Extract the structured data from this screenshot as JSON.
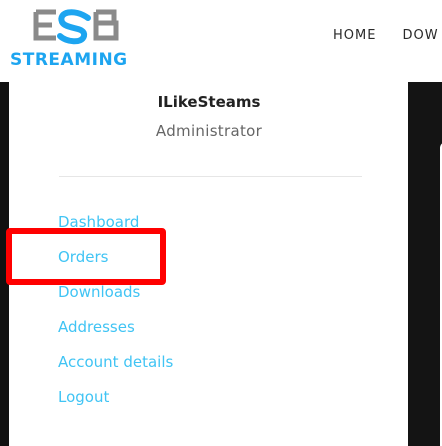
{
  "brand": {
    "logo_text": "STREAMING"
  },
  "nav": [
    {
      "label": "HOME"
    },
    {
      "label": "DOW"
    }
  ],
  "user": {
    "name": "ILikeSteams",
    "role": "Administrator"
  },
  "account_menu": [
    {
      "label": "Dashboard"
    },
    {
      "label": "Orders"
    },
    {
      "label": "Downloads"
    },
    {
      "label": "Addresses"
    },
    {
      "label": "Account details"
    },
    {
      "label": "Logout"
    }
  ],
  "colors": {
    "brand_blue": "#1da5f0",
    "link": "#40c4f4",
    "highlight": "#ff0000",
    "page_bg": "#000000"
  }
}
